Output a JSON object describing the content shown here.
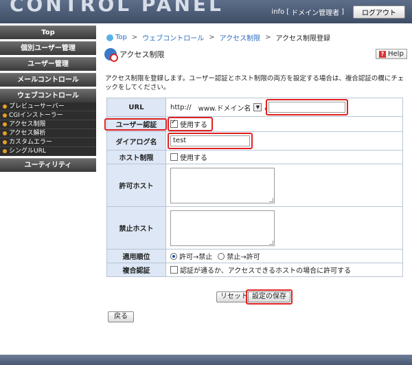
{
  "header": {
    "logo": "CONTROL PANEL",
    "info_label": "info",
    "bracket_open": "[",
    "user": "ドメイン管理者",
    "bracket_close": "]",
    "logout_label": "ログアウト"
  },
  "sidebar": {
    "items": [
      {
        "label": "Top"
      },
      {
        "label": "個別ユーザー管理"
      },
      {
        "label": "ユーザー管理"
      },
      {
        "label": "メールコントロール"
      },
      {
        "label": "ウェブコントロール"
      }
    ],
    "subitems": [
      {
        "label": "プレビューサーバー"
      },
      {
        "label": "CGIインストーラー"
      },
      {
        "label": "アクセス制限"
      },
      {
        "label": "アクセス解析"
      },
      {
        "label": "カスタムエラー"
      },
      {
        "label": "シングルURL"
      }
    ],
    "utility": "ユーティリティ"
  },
  "breadcrumb": {
    "items": [
      "Top",
      "ウェブコントロール",
      "アクセス制限"
    ],
    "separator": ">",
    "current": "アクセス制限登録"
  },
  "page": {
    "title": "アクセス制限",
    "help_label": "Help",
    "description": "アクセス制限を登録します。ユーザー認証とホスト制限の両方を設定する場合は、複合認証の欄にチェックをしてください。"
  },
  "form": {
    "url_label": "URL",
    "url_prefix": "http://",
    "url_domain": "www.ドメイン名",
    "url_slash": "/",
    "url_path_value": "",
    "auth_label": "ユーザー認証",
    "auth_checkbox": "使用する",
    "dialog_label": "ダイアログ名",
    "dialog_value": "test",
    "host_label": "ホスト制限",
    "host_checkbox": "使用する",
    "allow_label": "許可ホスト",
    "deny_label": "禁止ホスト",
    "order_label": "適用順位",
    "order_options": [
      "許可→禁止",
      "禁止→許可"
    ],
    "multi_label": "複合認証",
    "multi_checkbox": "認証が通るか、アクセスできるホストの場合に許可する"
  },
  "buttons": {
    "reset": "リセット",
    "save": "設定の保存",
    "back": "戻る"
  },
  "colors": {
    "highlight": "#e02020",
    "label_bg": "#dde7f5",
    "link": "#2a6bbf"
  }
}
